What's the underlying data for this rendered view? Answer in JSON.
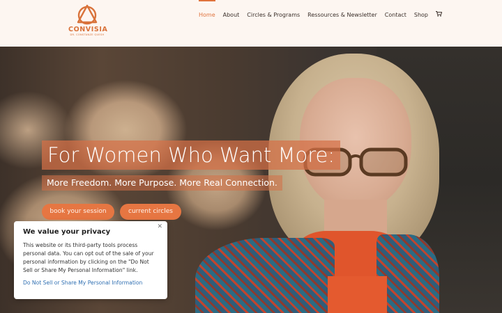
{
  "header": {
    "logo": {
      "name": "CONVISIA",
      "tagline": "DR. CONSTANZE QUESH"
    },
    "nav": [
      {
        "label": "Home",
        "active": true
      },
      {
        "label": "About",
        "active": false
      },
      {
        "label": "Circles & Programs",
        "active": false
      },
      {
        "label": "Ressources & Newsletter",
        "active": false
      },
      {
        "label": "Contact",
        "active": false
      },
      {
        "label": "Shop",
        "active": false
      }
    ],
    "cart_icon": "cart-icon"
  },
  "hero": {
    "headline": "For Women Who Want More:",
    "subline": "More Freedom. More Purpose. More Real Connection.",
    "buttons": {
      "book": "book your session",
      "circles": "current circles"
    }
  },
  "privacy": {
    "title": "We value your privacy",
    "close_icon": "close-icon",
    "body": "This website or its third-party tools process personal data. You can opt out of the sale of your personal information by clicking on the \"Do Not Sell or Share My Personal Information\" link.",
    "link": "Do Not Sell or Share My Personal Information"
  },
  "colors": {
    "accent": "#e0733d",
    "header_bg": "#fdf6f1",
    "link": "#2f6fb2"
  }
}
